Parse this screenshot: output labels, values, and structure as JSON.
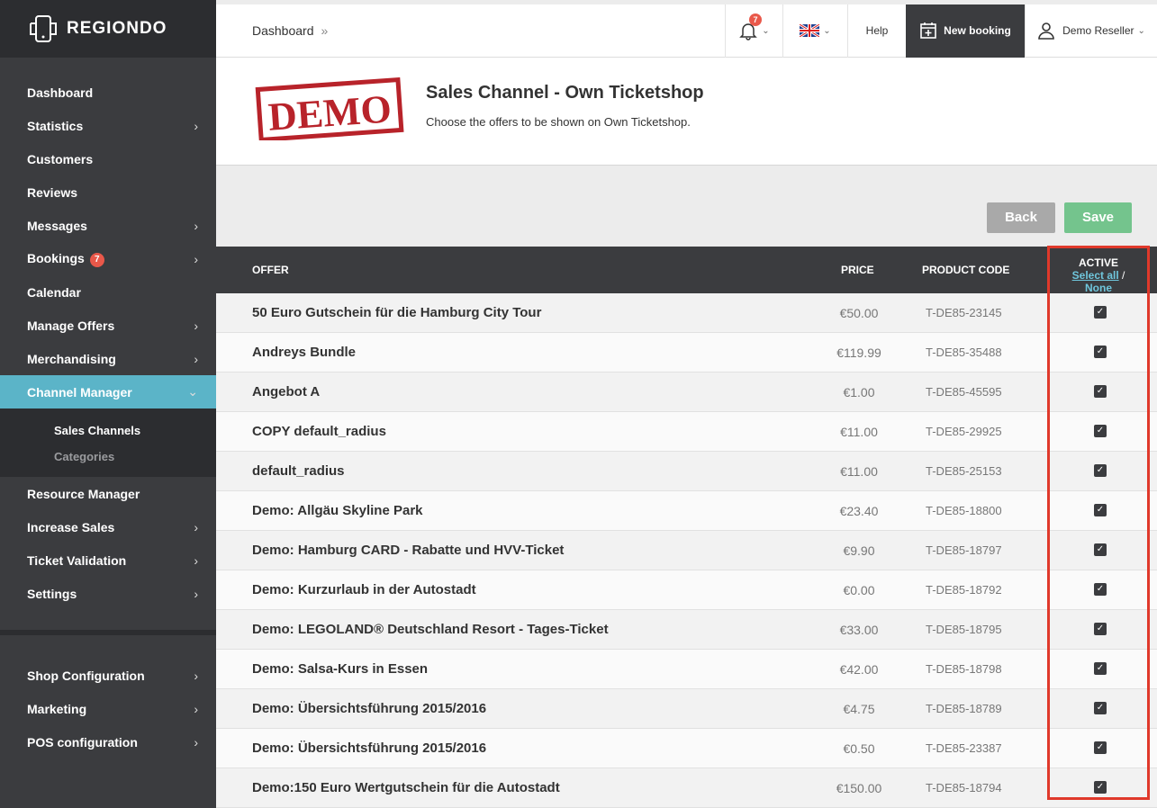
{
  "brand": {
    "name": "REGIONDO"
  },
  "sidebar": {
    "items": [
      {
        "label": "Dashboard",
        "arrow": false
      },
      {
        "label": "Statistics",
        "arrow": true
      },
      {
        "label": "Customers",
        "arrow": false
      },
      {
        "label": "Reviews",
        "arrow": false
      },
      {
        "label": "Messages",
        "arrow": true
      },
      {
        "label": "Bookings",
        "arrow": true,
        "badge": "7"
      },
      {
        "label": "Calendar",
        "arrow": false
      },
      {
        "label": "Manage Offers",
        "arrow": true
      },
      {
        "label": "Merchandising",
        "arrow": true
      },
      {
        "label": "Channel Manager",
        "arrow": true,
        "active": true
      }
    ],
    "subitems": [
      {
        "label": "Sales Channels"
      },
      {
        "label": "Categories"
      }
    ],
    "items2": [
      {
        "label": "Resource Manager",
        "arrow": false
      },
      {
        "label": "Increase Sales",
        "arrow": true
      },
      {
        "label": "Ticket Validation",
        "arrow": true
      },
      {
        "label": "Settings",
        "arrow": true
      }
    ],
    "items3": [
      {
        "label": "Shop Configuration",
        "arrow": true
      },
      {
        "label": "Marketing",
        "arrow": true
      },
      {
        "label": "POS configuration",
        "arrow": true
      }
    ]
  },
  "topbar": {
    "breadcrumb": "Dashboard",
    "breadcrumb_sep": "»",
    "notifications": "7",
    "help": "Help",
    "new_booking": "New booking",
    "user": "Demo Reseller"
  },
  "header": {
    "stamp": "DEMO",
    "title": "Sales Channel - Own Ticketshop",
    "subtitle": "Choose the offers to be shown on Own Ticketshop."
  },
  "actions": {
    "back": "Back",
    "save": "Save"
  },
  "table": {
    "headers": {
      "offer": "OFFER",
      "price": "PRICE",
      "code": "PRODUCT CODE",
      "active": "ACTIVE",
      "select_all": "Select all",
      "slash": "/",
      "none": "None"
    },
    "rows": [
      {
        "offer": "50 Euro Gutschein für die Hamburg City Tour",
        "price": "€50.00",
        "code": "T-DE85-23145",
        "active": true
      },
      {
        "offer": "Andreys Bundle",
        "price": "€119.99",
        "code": "T-DE85-35488",
        "active": true
      },
      {
        "offer": "Angebot A",
        "price": "€1.00",
        "code": "T-DE85-45595",
        "active": true
      },
      {
        "offer": "COPY default_radius",
        "price": "€11.00",
        "code": "T-DE85-29925",
        "active": true
      },
      {
        "offer": "default_radius",
        "price": "€11.00",
        "code": "T-DE85-25153",
        "active": true
      },
      {
        "offer": "Demo: Allgäu Skyline Park",
        "price": "€23.40",
        "code": "T-DE85-18800",
        "active": true
      },
      {
        "offer": "Demo: Hamburg CARD - Rabatte und HVV-Ticket",
        "price": "€9.90",
        "code": "T-DE85-18797",
        "active": true
      },
      {
        "offer": "Demo: Kurzurlaub in der Autostadt",
        "price": "€0.00",
        "code": "T-DE85-18792",
        "active": true
      },
      {
        "offer": "Demo: LEGOLAND® Deutschland Resort - Tages-Ticket",
        "price": "€33.00",
        "code": "T-DE85-18795",
        "active": true
      },
      {
        "offer": "Demo: Salsa-Kurs in Essen",
        "price": "€42.00",
        "code": "T-DE85-18798",
        "active": true
      },
      {
        "offer": "Demo: Übersichtsführung 2015/2016",
        "price": "€4.75",
        "code": "T-DE85-18789",
        "active": true
      },
      {
        "offer": "Demo: Übersichtsführung 2015/2016",
        "price": "€0.50",
        "code": "T-DE85-23387",
        "active": true
      },
      {
        "offer": "Demo:150 Euro Wertgutschein für die Autostadt",
        "price": "€150.00",
        "code": "T-DE85-18794",
        "active": true
      }
    ]
  },
  "colors": {
    "sidebar_bg": "#3b3c3f",
    "active_nav": "#5bb4c8",
    "save_green": "#74c48d",
    "highlight_red": "#e0392b"
  }
}
